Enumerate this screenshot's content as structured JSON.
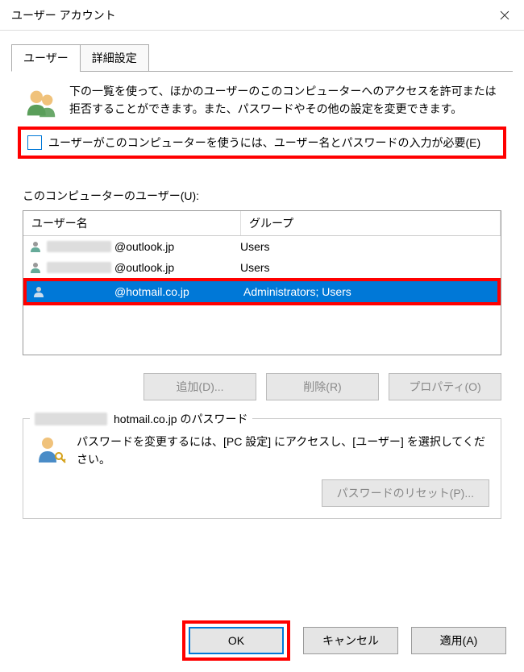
{
  "titlebar": {
    "title": "ユーザー アカウント"
  },
  "tabs": {
    "users": "ユーザー",
    "advanced": "詳細設定"
  },
  "intro": {
    "text": "下の一覧を使って、ほかのユーザーのこのコンピューターへのアクセスを許可または拒否することができます。また、パスワードやその他の設定を変更できます。"
  },
  "checkbox": {
    "label": "ユーザーがこのコンピューターを使うには、ユーザー名とパスワードの入力が必要(E)",
    "checked": false
  },
  "userlist": {
    "label": "このコンピューターのユーザー(U):",
    "columns": {
      "name": "ユーザー名",
      "group": "グループ"
    },
    "rows": [
      {
        "domain": "@outlook.jp",
        "group": "Users",
        "selected": false
      },
      {
        "domain": "@outlook.jp",
        "group": "Users",
        "selected": false
      },
      {
        "domain": "@hotmail.co.jp",
        "group": "Administrators; Users",
        "selected": true
      }
    ]
  },
  "buttons": {
    "add": "追加(D)...",
    "remove": "削除(R)",
    "properties": "プロパティ(O)",
    "reset_password": "パスワードのリセット(P)...",
    "ok": "OK",
    "cancel": "キャンセル",
    "apply": "適用(A)"
  },
  "password_panel": {
    "title_suffix": "hotmail.co.jp のパスワード",
    "body": "パスワードを変更するには、[PC 設定] にアクセスし、[ユーザー] を選択してください。"
  }
}
